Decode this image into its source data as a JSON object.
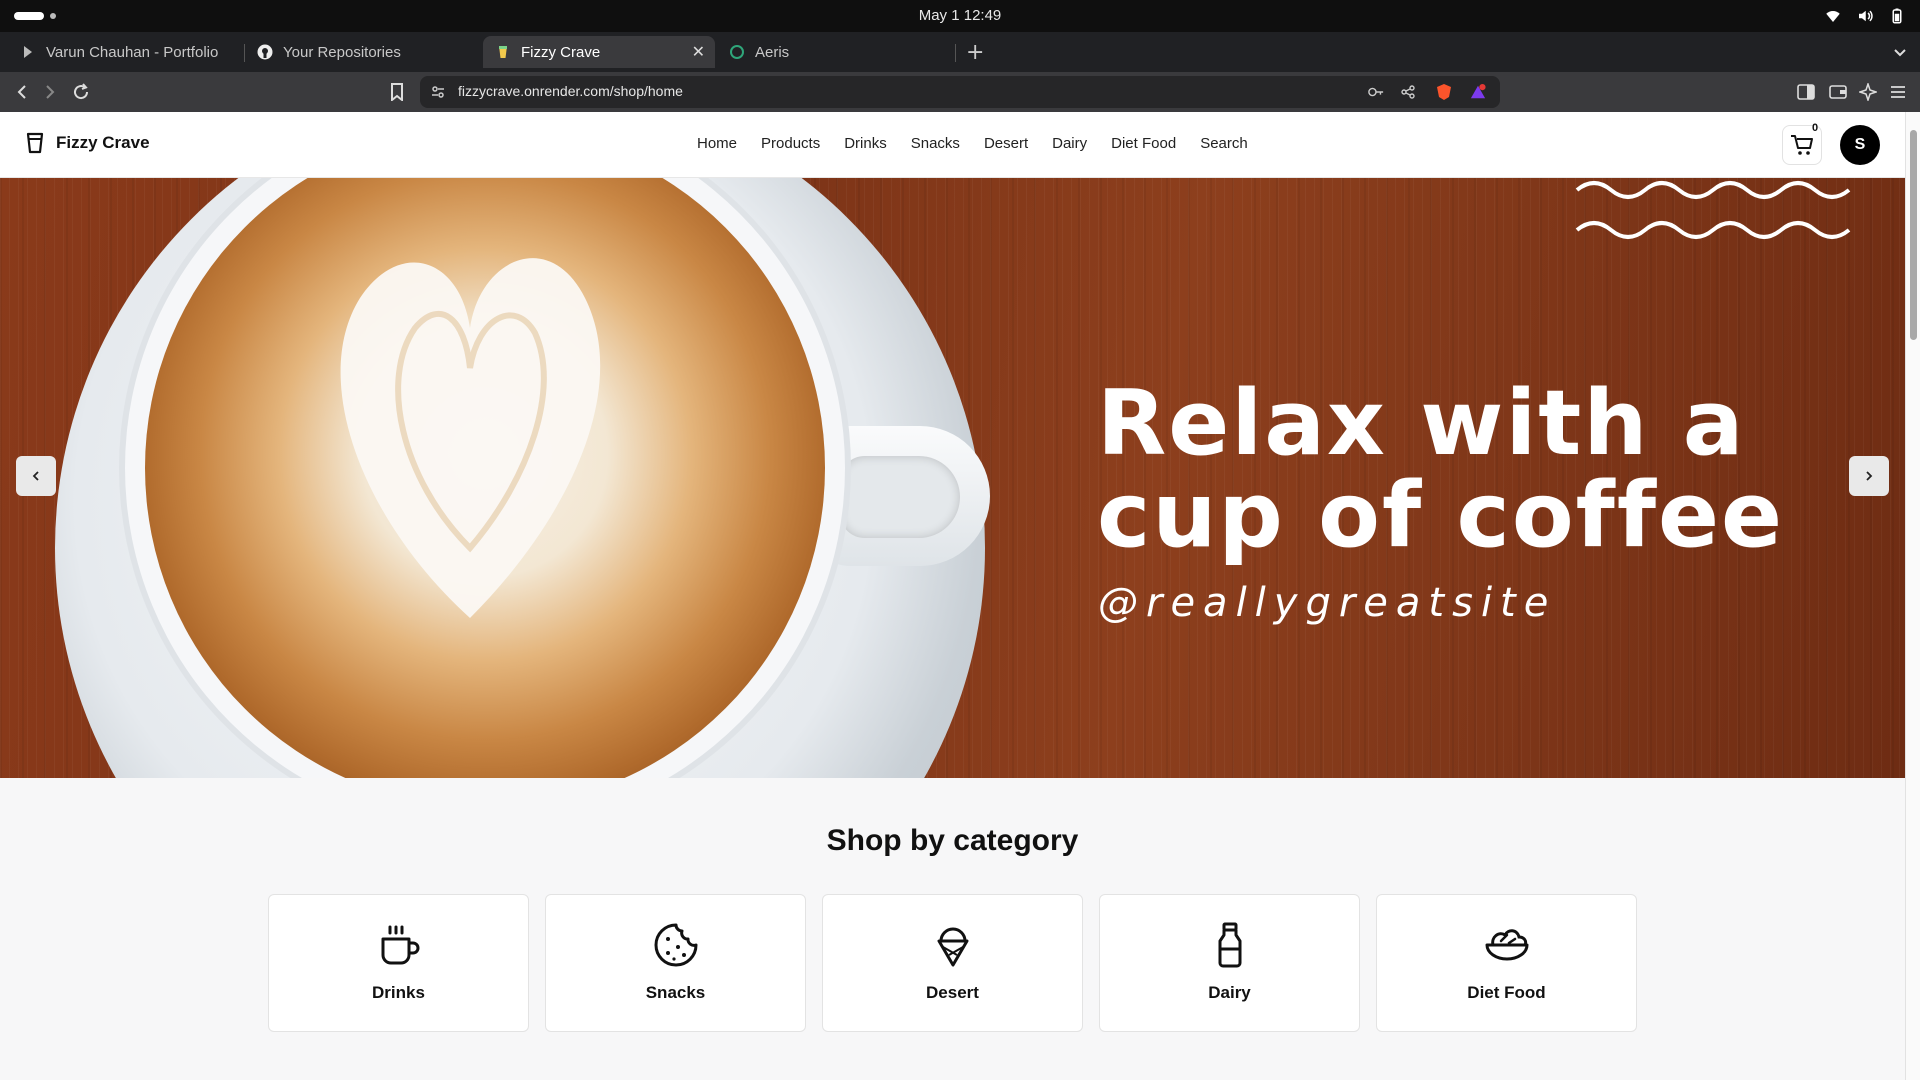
{
  "os": {
    "clock": "May 1  12:49"
  },
  "browser": {
    "tabs": [
      {
        "title": "Varun Chauhan - Portfolio",
        "icon": "portfolio-favicon"
      },
      {
        "title": "Your Repositories",
        "icon": "github-icon"
      },
      {
        "title": "Fizzy Crave",
        "icon": "fizzy-crave-favicon",
        "active": true
      },
      {
        "title": "Aeris",
        "icon": "aeris-favicon"
      }
    ],
    "url": "fizzycrave.onrender.com/shop/home"
  },
  "site": {
    "brand": "Fizzy Crave",
    "menu": [
      "Home",
      "Products",
      "Drinks",
      "Snacks",
      "Desert",
      "Dairy",
      "Diet Food",
      "Search"
    ],
    "cart_count": "0",
    "avatar_initial": "S"
  },
  "hero": {
    "headline_line1": "Relax with a",
    "headline_line2": "cup of coffee",
    "handle": "@reallygreatsite"
  },
  "categories": {
    "title": "Shop by category",
    "items": [
      {
        "label": "Drinks",
        "icon": "mug-icon"
      },
      {
        "label": "Snacks",
        "icon": "cookie-icon"
      },
      {
        "label": "Desert",
        "icon": "ice-cream-icon"
      },
      {
        "label": "Dairy",
        "icon": "milk-bottle-icon"
      },
      {
        "label": "Diet Food",
        "icon": "salad-bowl-icon"
      }
    ]
  }
}
